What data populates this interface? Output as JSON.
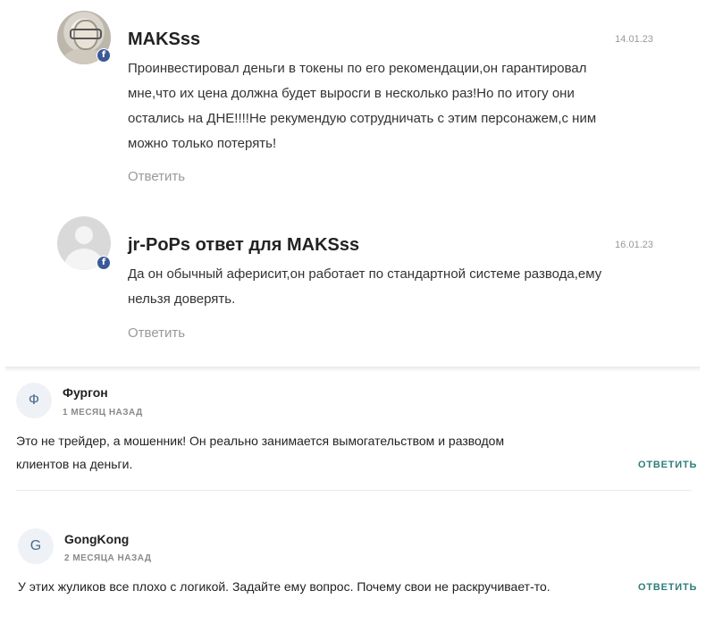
{
  "comments": [
    {
      "author": "MAKSss",
      "date": "14.01.23",
      "text": "Проинвестировал деньги в токены по его рекомендации,он гарантировал мне,что их цена должна будет выросги в несколько раз!Но по итогу они остались на ДНЕ!!!!Не рекумендую сотрудничать с этим персонажем,с ним можно только потерять!",
      "lines": [
        "Проинвестировал деньги в токены по его рекомендации,он гарантировал",
        "мне,что их цена должна будет выросги в несколько раз!Но по итогу они",
        "остались на ДНЕ!!!!Не рекумендую сотрудничать с этим персонажем,с ним",
        "можно только потерять!"
      ],
      "reply_label": "Ответить",
      "badge": "f"
    },
    {
      "author": "jr-PoPs ответ для MAKSss",
      "date": "16.01.23",
      "lines": [
        "Да он обычный аферисит,он работает по стандартной системе развода,ему",
        "нельзя доверять."
      ],
      "reply_label": "Ответить",
      "badge": "f"
    }
  ],
  "bottom_comments": [
    {
      "initial": "Ф",
      "author": "Фургон",
      "ago": "1 МЕСЯЦ НАЗАД",
      "lines": [
        "Это не трейдер, а мошенник! Он реально занимается вымогательством и разводом",
        "клиентов на деньги."
      ],
      "reply_label": "ОТВЕТИТЬ"
    },
    {
      "initial": "G",
      "author": "GongKong",
      "ago": "2 МЕСЯЦА НАЗАД",
      "lines": [
        "У этих жуликов все плохо с логикой. Задайте ему вопрос. Почему свои не раскручивает-то."
      ],
      "reply_label": "ОТВЕТИТЬ"
    }
  ]
}
